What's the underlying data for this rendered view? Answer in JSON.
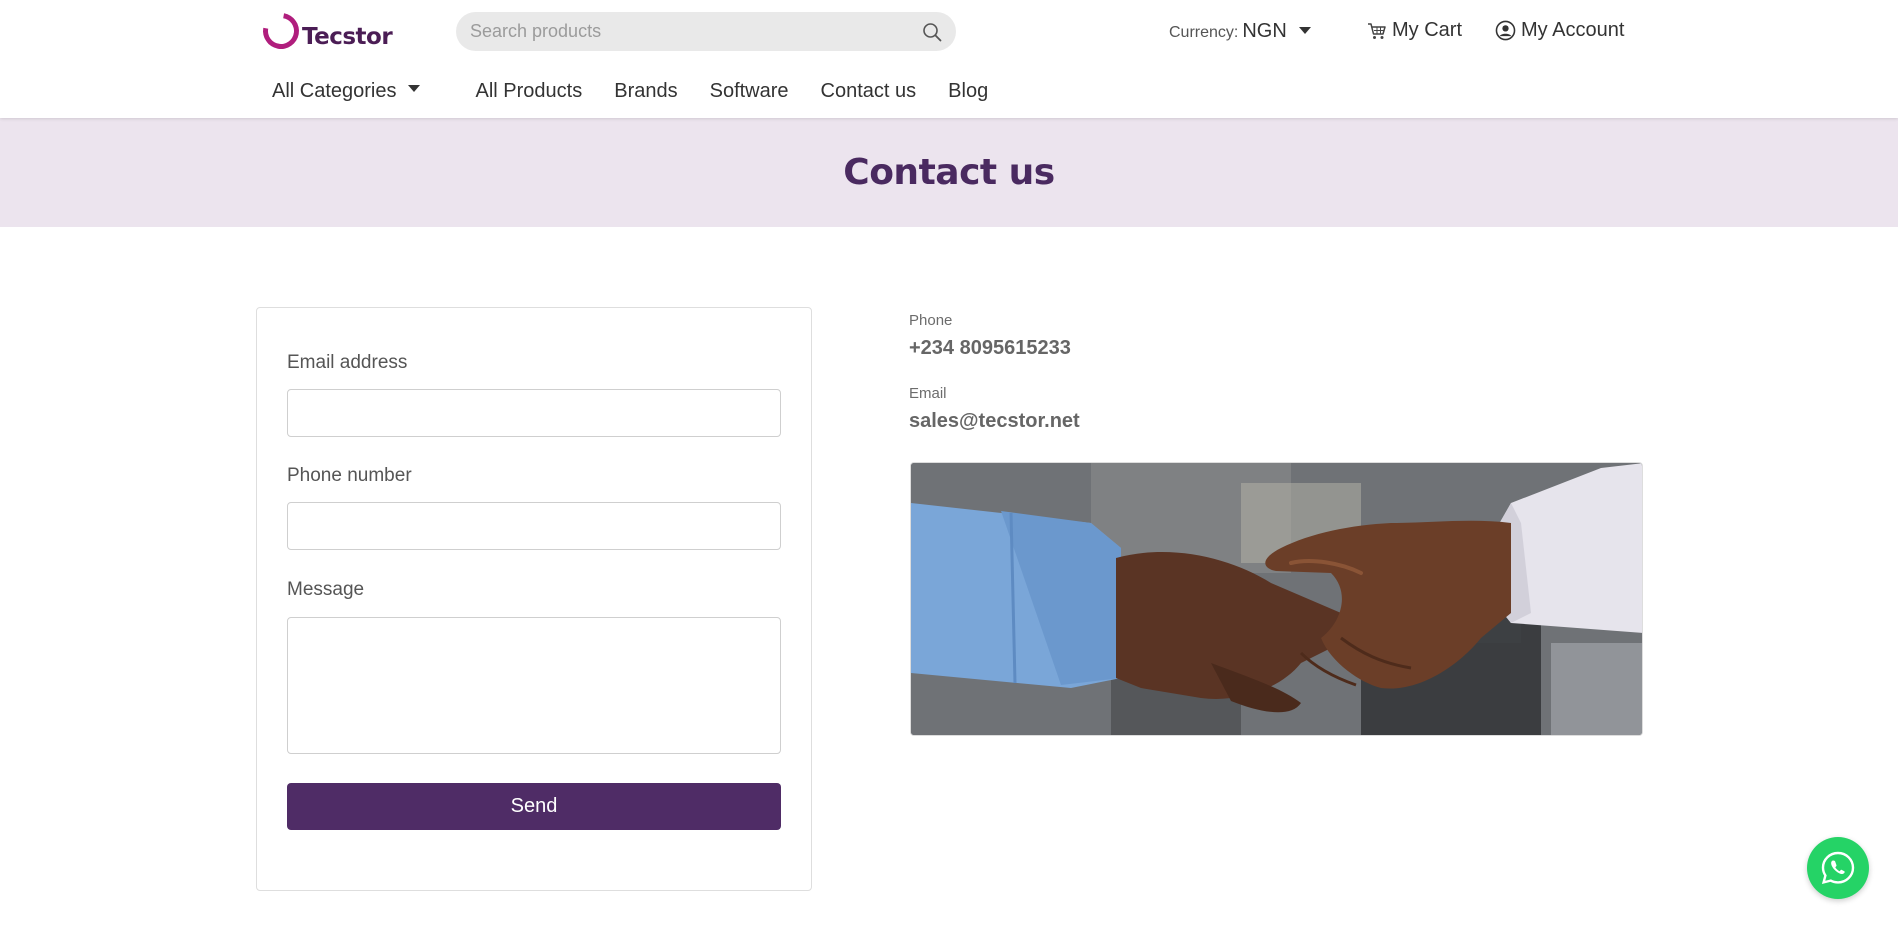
{
  "header": {
    "logo_text": "Tecstor",
    "search_placeholder": "Search products",
    "currency_label": "Currency:",
    "currency_value": "NGN",
    "cart_label": "My Cart",
    "account_label": "My Account"
  },
  "nav": {
    "categories_label": "All Categories",
    "links": [
      "All Products",
      "Brands",
      "Software",
      "Contact us",
      "Blog"
    ]
  },
  "banner": {
    "title": "Contact us"
  },
  "form": {
    "email_label": "Email  address",
    "phone_label": "Phone  number",
    "message_label": "Message",
    "email_value": "",
    "phone_value": "",
    "message_value": "",
    "send_label": "Send"
  },
  "contact": {
    "phone_label": "Phone",
    "phone_value": "+234  8095615233",
    "email_label": "Email",
    "email_value": "sales@tecstor.net"
  },
  "colors": {
    "brand_purple": "#4f2c66",
    "banner_bg": "#ece4ee",
    "logo_magenta": "#b01e7d",
    "whatsapp_green": "#25d366"
  },
  "icons": {
    "search": "search-icon",
    "cart": "cart-icon",
    "account": "user-circle-icon",
    "whatsapp": "whatsapp-icon",
    "dropdown": "caret-down-icon"
  }
}
